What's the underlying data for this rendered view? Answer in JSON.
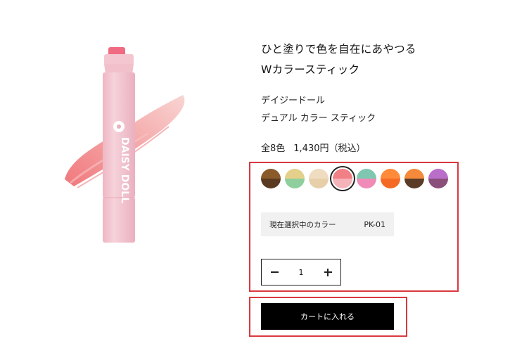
{
  "product": {
    "tagline_line1": "ひと塗りで色を自在にあやつる",
    "tagline_line2": "Wカラースティック",
    "brand": "デイジードール",
    "name": "デュアル カラー スティック",
    "variant_count": "全8色",
    "price": "1,430円（税込）",
    "package_text": "DAISY DOLL"
  },
  "swatches": [
    {
      "id": "swatch-1",
      "top": "#8a5a2b",
      "bottom": "#5a3a20"
    },
    {
      "id": "swatch-2",
      "top": "#e4d08a",
      "bottom": "#8ecf9d"
    },
    {
      "id": "swatch-3",
      "top": "#f0dcc0",
      "bottom": "#e6cfa9"
    },
    {
      "id": "swatch-4",
      "top": "#f07f86",
      "bottom": "#f4b3b8",
      "selected": true
    },
    {
      "id": "swatch-5",
      "top": "#7fc7b1",
      "bottom": "#f08ab6"
    },
    {
      "id": "swatch-6",
      "top": "#ff8a3a",
      "bottom": "#f46a23"
    },
    {
      "id": "swatch-7",
      "top": "#f48a3a",
      "bottom": "#5a3b28"
    },
    {
      "id": "swatch-8",
      "top": "#b96ec9",
      "bottom": "#8a4e7a"
    }
  ],
  "selected_color": {
    "label": "現在選択中のカラー",
    "code": "PK-01"
  },
  "quantity": {
    "value": "1"
  },
  "cart": {
    "button_label": "カートに入れる"
  },
  "colors": {
    "highlight": "#d9393e",
    "button_bg": "#000000",
    "selected_bg": "#f1f1f1"
  }
}
